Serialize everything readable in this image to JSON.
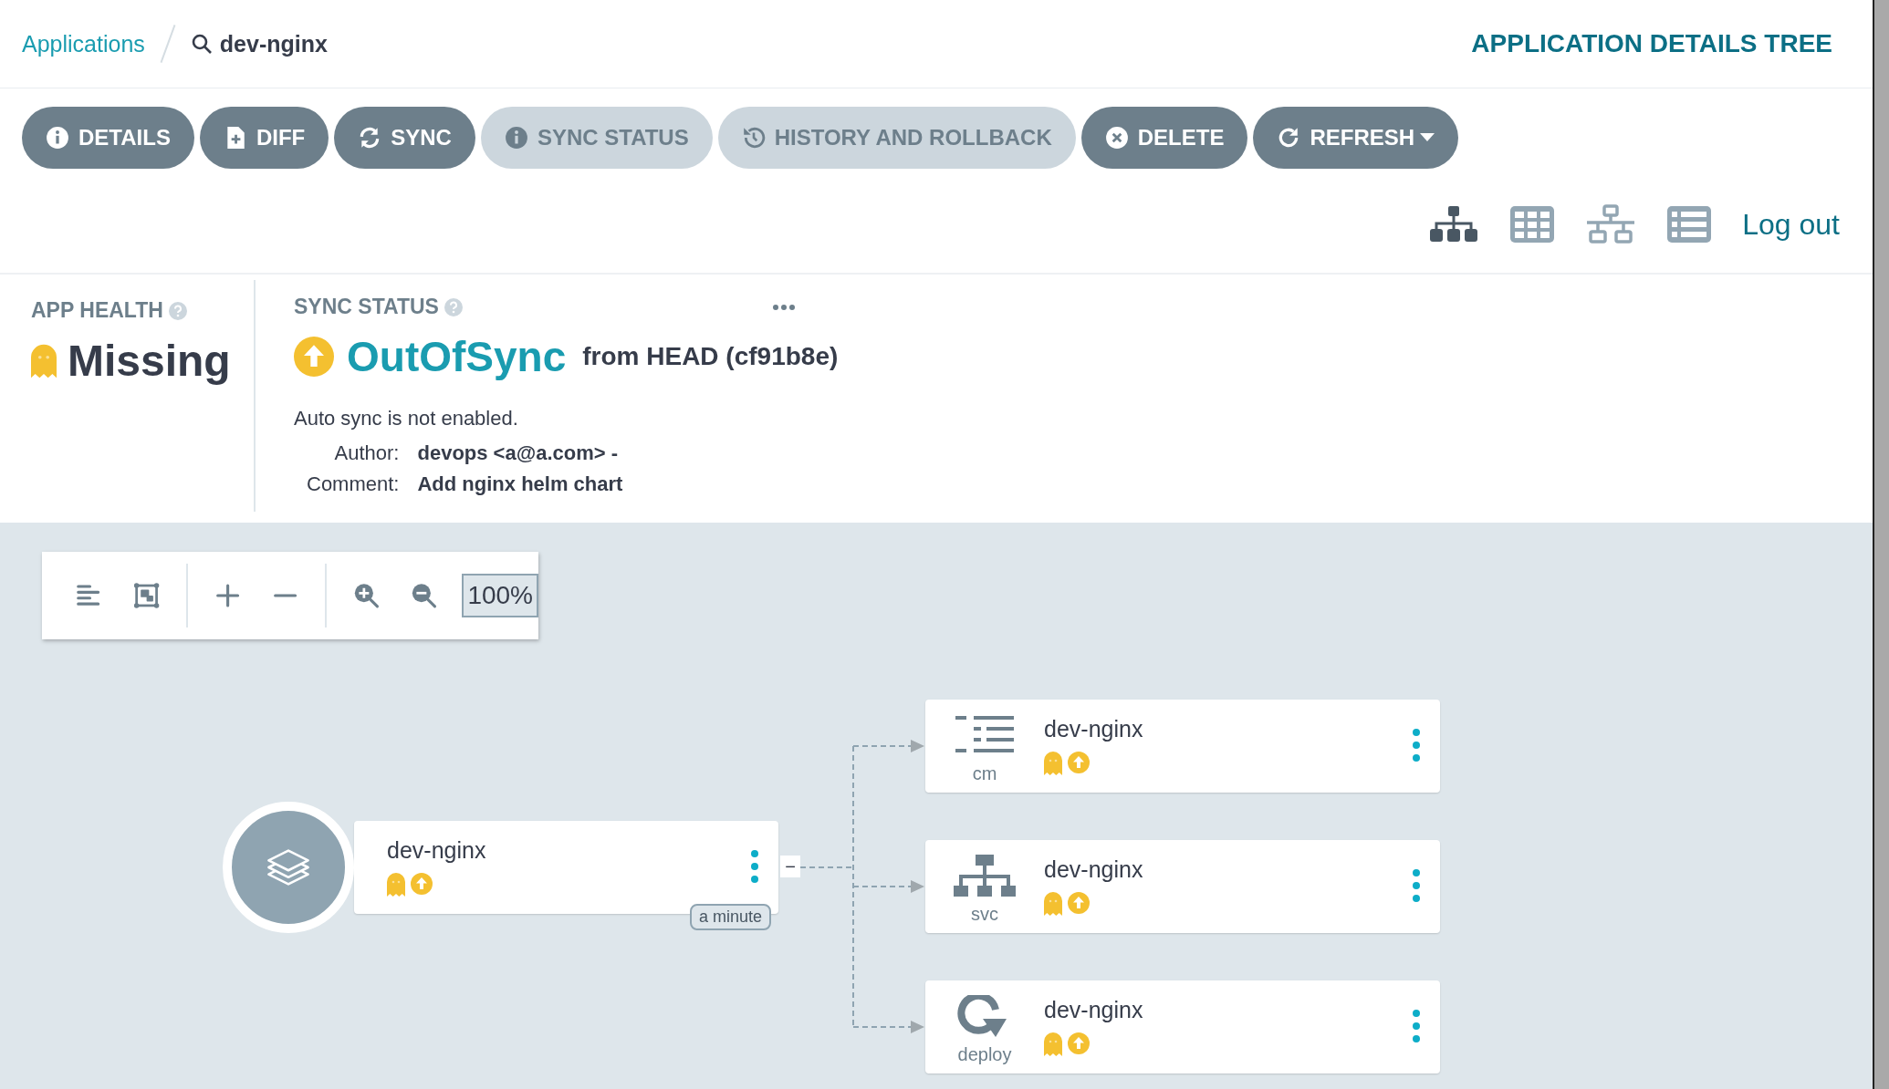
{
  "breadcrumb": {
    "parent": "Applications",
    "current": "dev-nginx"
  },
  "page_title": "APPLICATION DETAILS TREE",
  "actions": [
    {
      "kind": "info",
      "label": "DETAILS",
      "disabled": false,
      "dropdown": false
    },
    {
      "kind": "file",
      "label": "DIFF",
      "disabled": false,
      "dropdown": false
    },
    {
      "kind": "sync",
      "label": "SYNC",
      "disabled": false,
      "dropdown": false
    },
    {
      "kind": "info",
      "label": "SYNC STATUS",
      "disabled": true,
      "dropdown": false
    },
    {
      "kind": "history",
      "label": "HISTORY AND ROLLBACK",
      "disabled": true,
      "dropdown": false
    },
    {
      "kind": "close",
      "label": "DELETE",
      "disabled": false,
      "dropdown": false
    },
    {
      "kind": "refresh",
      "label": "REFRESH",
      "disabled": false,
      "dropdown": true
    }
  ],
  "view_modes": [
    {
      "kind": "tree",
      "selected": true
    },
    {
      "kind": "grid",
      "selected": false
    },
    {
      "kind": "network",
      "selected": false
    },
    {
      "kind": "list",
      "selected": false
    }
  ],
  "logout": "Log out",
  "app_health": {
    "label": "APP HEALTH",
    "value": "Missing"
  },
  "sync_status": {
    "label": "SYNC STATUS",
    "value": "OutOfSync",
    "revision": "from HEAD (cf91b8e)",
    "note": "Auto sync is not enabled.",
    "details": [
      {
        "label": "Author:",
        "value": "devops <a@a.com> -"
      },
      {
        "label": "Comment:",
        "value": "Add nginx helm chart"
      }
    ]
  },
  "zoom": "100%",
  "graph": {
    "root": {
      "name": "dev-nginx",
      "age": "a minute",
      "collapse_toggle": "−"
    },
    "children": [
      {
        "kind": "cm",
        "label": "cm",
        "name": "dev-nginx"
      },
      {
        "kind": "svc",
        "label": "svc",
        "name": "dev-nginx"
      },
      {
        "kind": "deploy",
        "label": "deploy",
        "name": "dev-nginx"
      }
    ]
  }
}
